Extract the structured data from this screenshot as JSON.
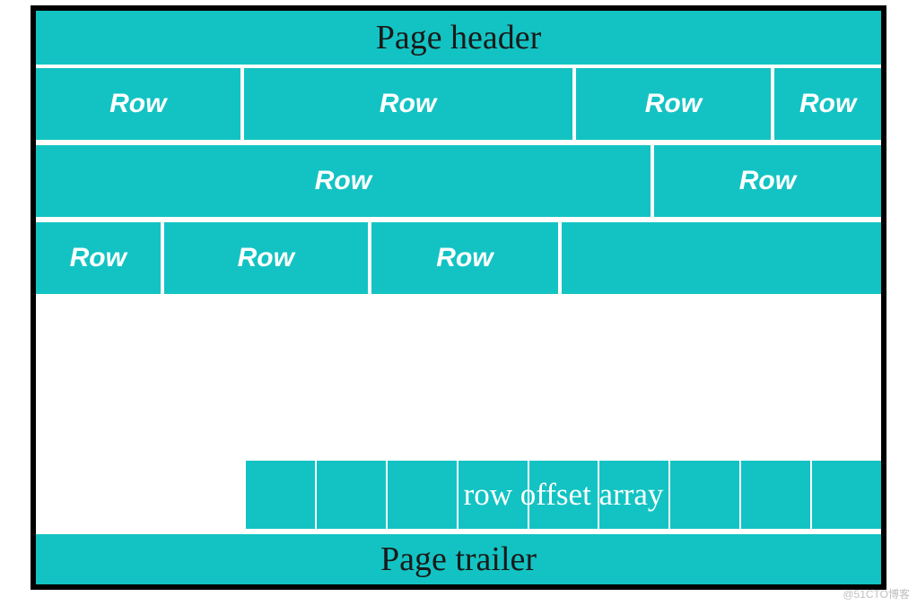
{
  "page": {
    "header": "Page header",
    "trailer": "Page trailer"
  },
  "rows": {
    "line1": {
      "c1": "Row",
      "c2": "Row",
      "c3": "Row",
      "c4": "Row"
    },
    "line2": {
      "c1": "Row",
      "c2": "Row"
    },
    "line3": {
      "c1": "Row",
      "c2": "Row",
      "c3": "Row"
    }
  },
  "offset": {
    "label": "row offset array",
    "cell_count": 9
  },
  "watermark": "@51CTO博客"
}
